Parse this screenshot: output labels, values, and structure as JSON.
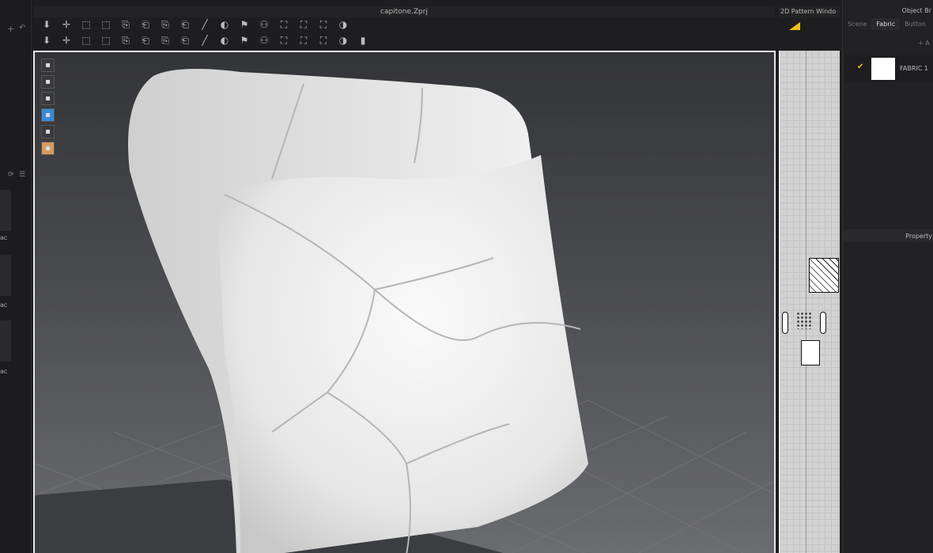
{
  "window": {
    "title": "capitone.Zprj"
  },
  "toolbar": {
    "row1": [
      "simulate",
      "transform-pattern",
      "select-mesh",
      "edit-pattern",
      "add-point",
      "segment-sew",
      "free-sew",
      "sewing-tool",
      "edit-pin",
      "fold-arrangement",
      "tack",
      "show-garment",
      "show-avatar",
      "tape",
      "measure",
      "ruler"
    ],
    "row2": [
      "avatar-pose",
      "select-garment",
      "fold",
      "steam",
      "fabric",
      "attach",
      "zipper",
      "button",
      "buttonhole",
      "line",
      "snap",
      "topstitch",
      "sticker",
      "puckering",
      "arrange",
      "fit",
      "morph"
    ]
  },
  "viewport": {
    "tools": [
      "garment-view",
      "garment-view-2",
      "avatar-view",
      "fabric-view",
      "flat-view",
      "skin-view"
    ]
  },
  "left_panel": {
    "items": [
      "ac",
      "ac",
      "ac"
    ]
  },
  "pattern_window": {
    "title": "2D Pattern Windo"
  },
  "object_browser": {
    "title": "Object Br",
    "tabs": [
      "Scene",
      "Fabric",
      "Button"
    ],
    "active_tab": "Fabric",
    "add_label": "+ A",
    "fabrics": [
      {
        "name": "FABRIC 1",
        "checked": true,
        "color": "#ffffff"
      }
    ]
  },
  "property": {
    "title": "Property"
  },
  "colors": {
    "accent": "#f0c020"
  }
}
